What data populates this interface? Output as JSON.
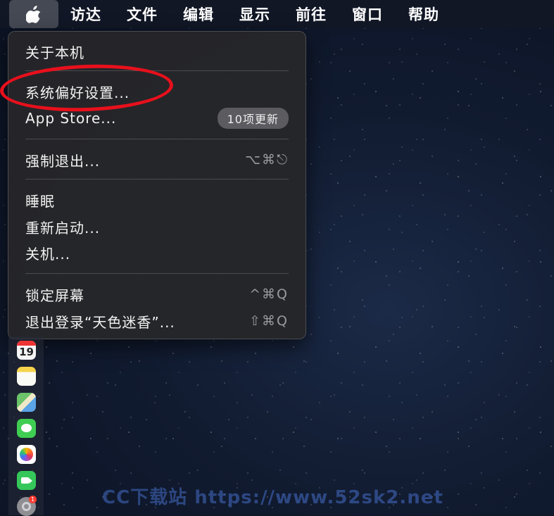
{
  "menubar": {
    "items": [
      "访达",
      "文件",
      "编辑",
      "显示",
      "前往",
      "窗口",
      "帮助"
    ]
  },
  "apple_menu": {
    "about": "关于本机",
    "system_prefs": "系统偏好设置...",
    "app_store": "App Store...",
    "app_store_badge": "10项更新",
    "force_quit": "强制退出...",
    "force_quit_shortcut": "⌥⌘⎋",
    "sleep": "睡眠",
    "restart": "重新启动...",
    "shutdown": "关机...",
    "lock_screen": "锁定屏幕",
    "lock_screen_shortcut": "^⌘Q",
    "logout": "退出登录“天色迷香”...",
    "logout_shortcut": "⇧⌘Q"
  },
  "dock": {
    "calendar_day": "19",
    "settings_badge": "1"
  },
  "watermark": "CC下载站 https://www.52sk2.net",
  "colors": {
    "highlight_oval": "#e8101c",
    "menu_bg": "#26262a"
  },
  "icons": [
    "apple-icon",
    "calendar-icon",
    "notes-icon",
    "maps-icon",
    "messages-icon",
    "photos-icon",
    "facetime-icon",
    "system-preferences-icon"
  ]
}
